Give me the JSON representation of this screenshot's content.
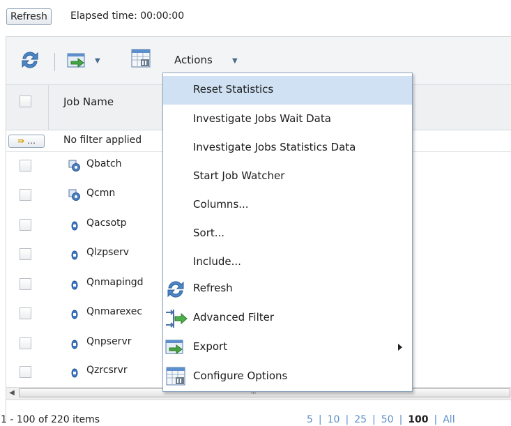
{
  "top": {
    "refresh_label": "Refresh",
    "elapsed_label": "Elapsed time: 00:00:00"
  },
  "toolbar": {
    "refresh_icon": "refresh-icon",
    "export_icon": "export-icon",
    "configure_icon": "configure-options-icon",
    "actions_label": "Actions"
  },
  "table": {
    "columns": [
      "Job Name"
    ],
    "filter_button": "…",
    "filter_text": "No filter applied",
    "rows": [
      {
        "name": "Qbatch",
        "icon": "subsystem-icon"
      },
      {
        "name": "Qcmn",
        "icon": "subsystem-icon"
      },
      {
        "name": "Qacsotp",
        "icon": "job-icon"
      },
      {
        "name": "Qlzpserv",
        "icon": "job-icon"
      },
      {
        "name": "Qnmapingd",
        "icon": "job-icon"
      },
      {
        "name": "Qnmarexec",
        "icon": "job-icon"
      },
      {
        "name": "Qnpservr",
        "icon": "job-icon"
      },
      {
        "name": "Qzrcsrvr",
        "icon": "job-icon"
      }
    ]
  },
  "menu": {
    "items": [
      {
        "label": "Reset Statistics",
        "highlighted": true
      },
      {
        "label": "Investigate Jobs Wait Data"
      },
      {
        "label": "Investigate Jobs Statistics Data"
      },
      {
        "label": "Start Job Watcher"
      },
      {
        "label": "Columns..."
      },
      {
        "label": "Sort..."
      },
      {
        "label": "Include..."
      },
      {
        "label": "Refresh",
        "icon": "refresh-icon"
      },
      {
        "label": "Advanced Filter",
        "icon": "advanced-filter-icon"
      },
      {
        "label": "Export",
        "icon": "export-icon",
        "submenu": true
      },
      {
        "label": "Configure Options",
        "icon": "configure-options-icon"
      }
    ]
  },
  "footer": {
    "count_label": "1 - 100 of 220 items",
    "page_sizes": [
      "5",
      "10",
      "25",
      "50",
      "100",
      "All"
    ],
    "current_page_size": "100"
  },
  "colors": {
    "menu_highlight": "#cfe1f3",
    "link": "#5b8fc9",
    "toolbar_bg": "#f3f4f6"
  }
}
